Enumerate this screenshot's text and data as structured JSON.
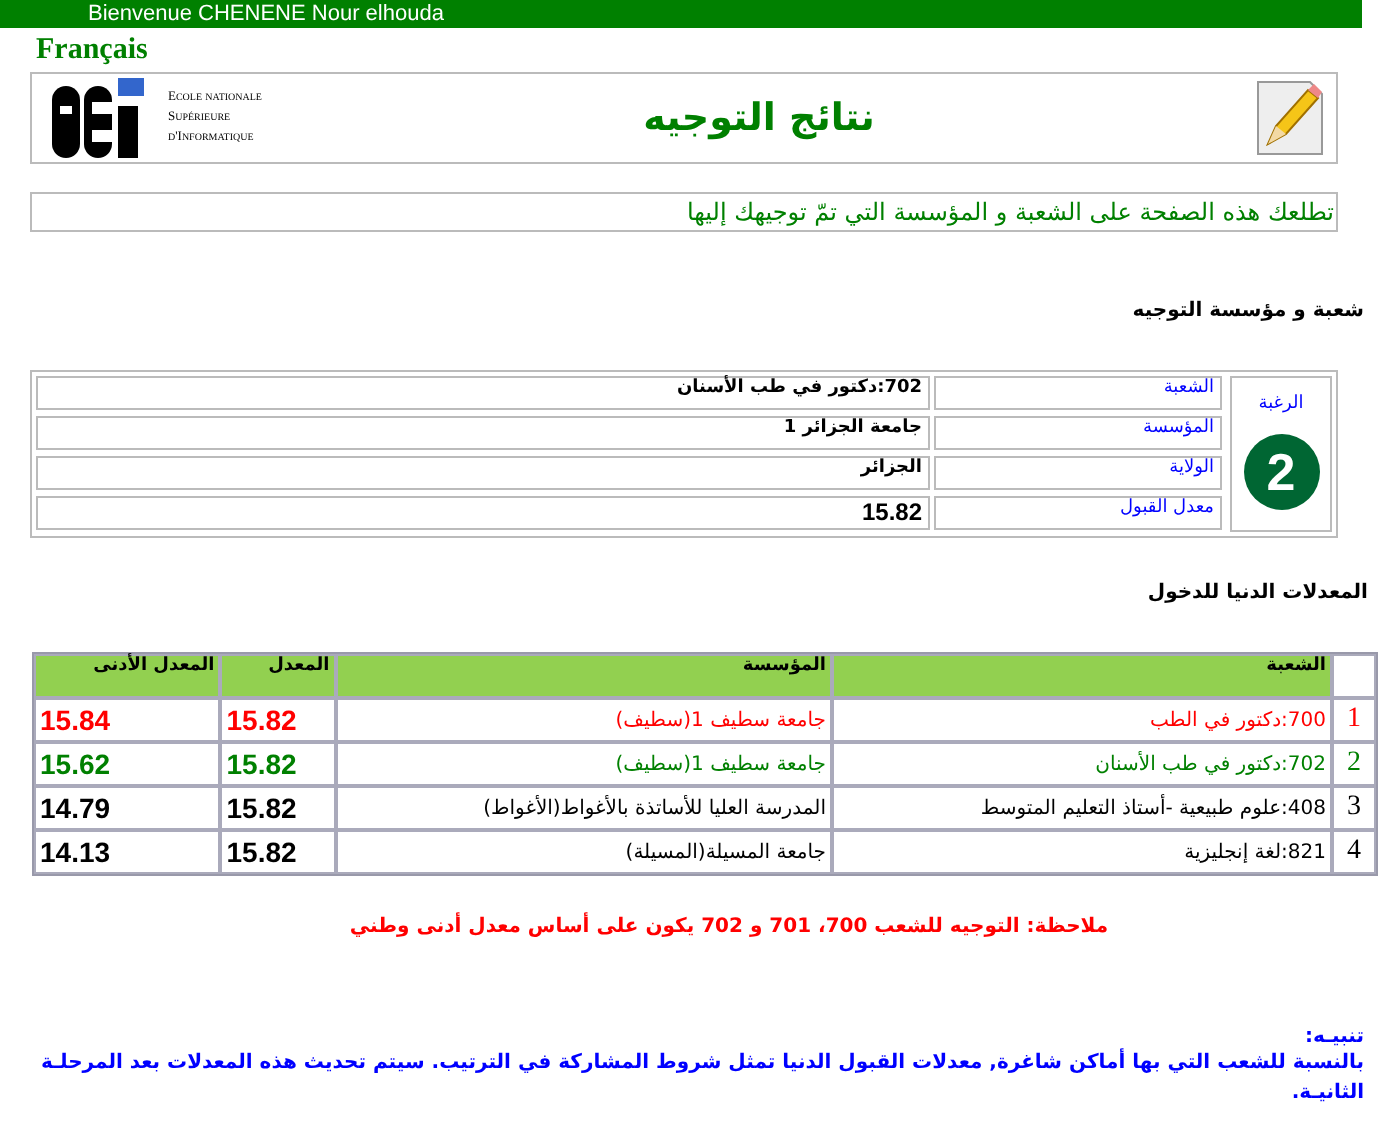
{
  "top_bar": {
    "welcome": "Bienvenue CHENENE Nour elhouda"
  },
  "language_link": "Français",
  "header": {
    "logo_lines": [
      "Ecole nationale",
      "Supérieure",
      "d'Informatique"
    ],
    "title": "نتائج التوجيه"
  },
  "intro": "تطلعك هذه الصفحة على الشعبة و المؤسسة التي تمّ توجيهك إليها",
  "assignment": {
    "heading": "شعبة و مؤسسة التوجيه",
    "choice_label": "الرغبة",
    "choice_number": "2",
    "fields": [
      {
        "label": "الشعبة",
        "value": "702:دكتور في طب الأسنان"
      },
      {
        "label": "المؤسسة",
        "value": "جامعة الجزائر 1"
      },
      {
        "label": "الولاية",
        "value": "الجزائر"
      },
      {
        "label": "معدل القبول",
        "value": "15.82"
      }
    ]
  },
  "minimums": {
    "heading": "المعدلات الدنيا للدخول",
    "columns": [
      "الشعبة",
      "المؤسسة",
      "المعدل",
      "المعدل الأدنى"
    ],
    "rows": [
      {
        "rank": "1",
        "track": "700:دكتور في الطب",
        "institution": "جامعة سطيف 1(سطيف)",
        "average": "15.82",
        "minimum": "15.84",
        "color": "#ff0000"
      },
      {
        "rank": "2",
        "track": "702:دكتور في طب الأسنان",
        "institution": "جامعة سطيف 1(سطيف)",
        "average": "15.82",
        "minimum": "15.62",
        "color": "#008000"
      },
      {
        "rank": "3",
        "track": "408:علوم طبيعية -أستاذ التعليم المتوسط",
        "institution": "المدرسة العليا للأساتذة بالأغواط(الأغواط)",
        "average": "15.82",
        "minimum": "14.79",
        "color": "#000000"
      },
      {
        "rank": "4",
        "track": "821:لغة إنجليزية",
        "institution": "جامعة المسيلة(المسيلة)",
        "average": "15.82",
        "minimum": "14.13",
        "color": "#000000"
      }
    ]
  },
  "note": "ملاحظة: التوجيه للشعب 700، 701 و 702 يكون على أساس معدل أدنى وطني",
  "warning": {
    "title": "تنبيـه:",
    "text": "بالنسبة للشعب التي بها أماكن شاغرة, معدلات القبول الدنيا تمثل شروط المشاركة في الترتيب. سيتم تحديث هذه المعدلات بعد المرحلـة الثانيـة."
  }
}
